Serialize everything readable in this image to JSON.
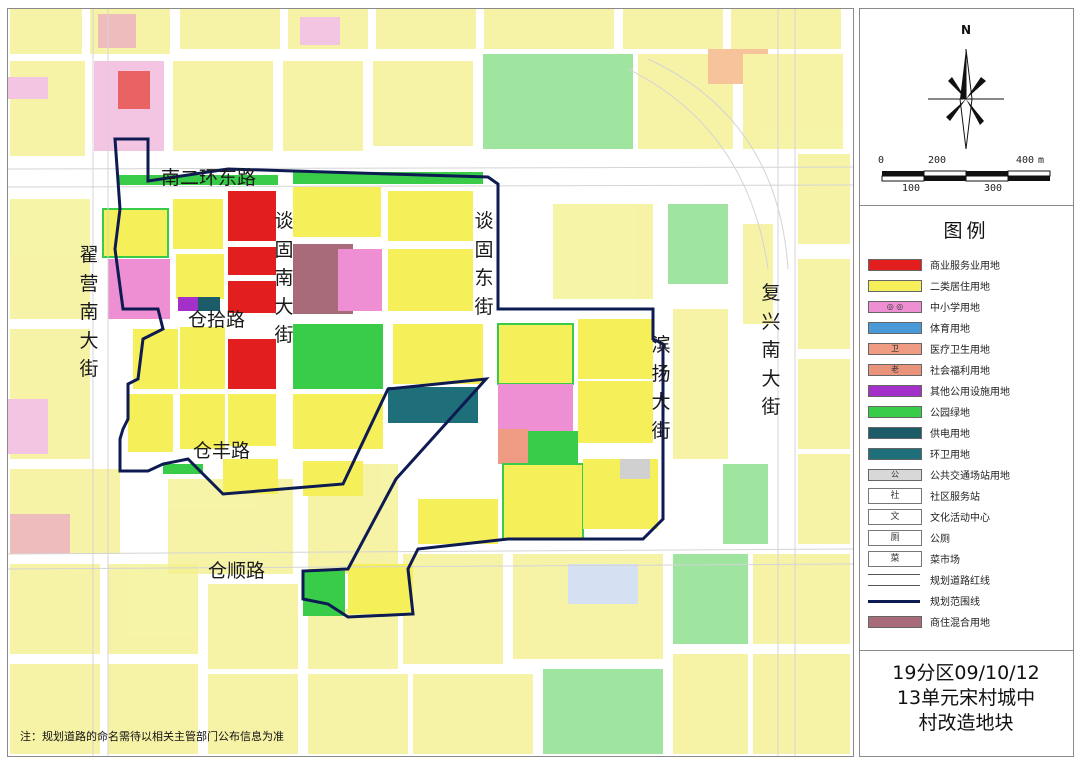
{
  "map": {
    "roads": {
      "nan_er_huan": "南二环东路",
      "cang_shi": "仓拾路",
      "cang_feng": "仓丰路",
      "cang_shun": "仓顺路",
      "zhai_ying_nan": [
        "翟",
        "营",
        "南",
        "大",
        "街"
      ],
      "tan_gu_nan": [
        "谈",
        "固",
        "南",
        "大",
        "街"
      ],
      "tan_gu_dong": [
        "谈",
        "固",
        "东",
        "街"
      ],
      "bin_yang": [
        "滨",
        "扬",
        "大",
        "街"
      ],
      "fu_xing_nan": [
        "复",
        "兴",
        "南",
        "大",
        "街"
      ]
    },
    "note": "注：规划道路的命名需待以相关主管部门公布信息为准"
  },
  "north_arrow": {
    "letter": "N"
  },
  "scale": {
    "top": [
      "0",
      "200",
      "400"
    ],
    "bottom": [
      "100",
      "300"
    ],
    "unit": "m"
  },
  "legend": {
    "title": "图例",
    "items": [
      {
        "label": "商业服务业用地",
        "color": "#e21e1e",
        "kind": "swatch"
      },
      {
        "label": "二类居住用地",
        "color": "#f5ef5a",
        "kind": "swatch"
      },
      {
        "label": "中小学用地",
        "color": "#ef8fd3",
        "kind": "swatch",
        "symbol": "◎ ◎"
      },
      {
        "label": "体育用地",
        "color": "#4a9ad9",
        "kind": "swatch"
      },
      {
        "label": "医疗卫生用地",
        "color": "#ef9a83",
        "kind": "swatch",
        "symbol": "卫"
      },
      {
        "label": "社会福利用地",
        "color": "#e9937a",
        "kind": "swatch",
        "symbol": "老"
      },
      {
        "label": "其他公用设施用地",
        "color": "#a330c9",
        "kind": "swatch"
      },
      {
        "label": "公园绿地",
        "color": "#39cc49",
        "kind": "swatch"
      },
      {
        "label": "供电用地",
        "color": "#1c5b68",
        "kind": "swatch"
      },
      {
        "label": "环卫用地",
        "color": "#1f6f7a",
        "kind": "swatch"
      },
      {
        "label": "公共交通场站用地",
        "color": "#d8d8d8",
        "kind": "swatch",
        "symbol": "公"
      },
      {
        "label": "社区服务站",
        "color": "#ffffff",
        "kind": "symbol",
        "symbol": "社"
      },
      {
        "label": "文化活动中心",
        "color": "#ffffff",
        "kind": "symbol",
        "symbol": "文"
      },
      {
        "label": "公厕",
        "color": "#ffffff",
        "kind": "symbol",
        "symbol": "厕"
      },
      {
        "label": "菜市场",
        "color": "#ffffff",
        "kind": "symbol",
        "symbol": "菜"
      },
      {
        "label": "规划道路红线",
        "color": "#ffffff",
        "kind": "road"
      },
      {
        "label": "规划范围线",
        "color": "#ffffff",
        "kind": "boundary"
      },
      {
        "label": "商住混合用地",
        "color": "#a86b79",
        "kind": "swatch"
      }
    ]
  },
  "plan_title": {
    "line1": "19分区09/10/12",
    "line2": "13单元宋村城中",
    "line3": "村改造地块"
  }
}
